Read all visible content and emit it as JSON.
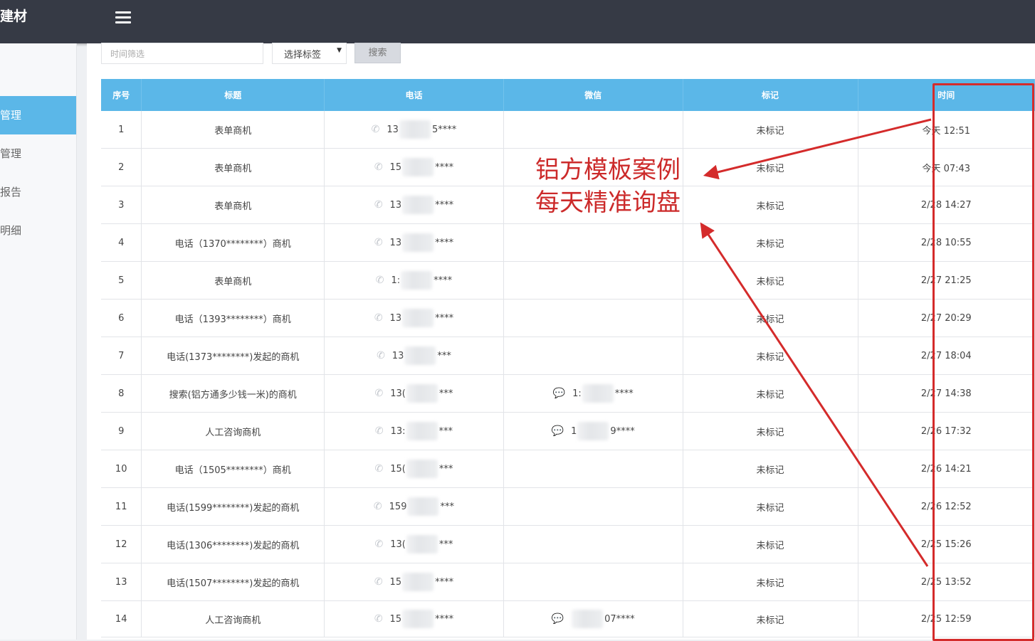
{
  "header": {
    "brand": "建材",
    "menu_icon": "hamburger-icon"
  },
  "sidebar": {
    "items": [
      {
        "label": "管理",
        "active": true
      },
      {
        "label": "管理",
        "active": false
      },
      {
        "label": "报告",
        "active": false
      },
      {
        "label": "明细",
        "active": false
      }
    ]
  },
  "filters": {
    "time_placeholder": "时间筛选",
    "tag_select": "选择标签",
    "search_label": "搜索"
  },
  "table": {
    "columns": [
      "序号",
      "标题",
      "电话",
      "微信",
      "标记",
      "时间"
    ],
    "rows": [
      {
        "no": "1",
        "title": "表单商机",
        "phone_prefix": "13",
        "phone_suffix": "5****",
        "wechat_prefix": "",
        "wechat_suffix": "",
        "mark": "未标记",
        "time": "今天 12:51"
      },
      {
        "no": "2",
        "title": "表单商机",
        "phone_prefix": "15",
        "phone_suffix": "****",
        "wechat_prefix": "",
        "wechat_suffix": "",
        "mark": "未标记",
        "time": "今天 07:43"
      },
      {
        "no": "3",
        "title": "表单商机",
        "phone_prefix": "13",
        "phone_suffix": "****",
        "wechat_prefix": "",
        "wechat_suffix": "",
        "mark": "未标记",
        "time": "2/28 14:27"
      },
      {
        "no": "4",
        "title": "电话（1370********）商机",
        "phone_prefix": "13",
        "phone_suffix": "****",
        "wechat_prefix": "",
        "wechat_suffix": "",
        "mark": "未标记",
        "time": "2/28 10:55"
      },
      {
        "no": "5",
        "title": "表单商机",
        "phone_prefix": "1:",
        "phone_suffix": "****",
        "wechat_prefix": "",
        "wechat_suffix": "",
        "mark": "未标记",
        "time": "2/27 21:25"
      },
      {
        "no": "6",
        "title": "电话（1393********）商机",
        "phone_prefix": "13",
        "phone_suffix": "****",
        "wechat_prefix": "",
        "wechat_suffix": "",
        "mark": "未标记",
        "time": "2/27 20:29"
      },
      {
        "no": "7",
        "title": "电话(1373********)发起的商机",
        "phone_prefix": "13",
        "phone_suffix": "***",
        "wechat_prefix": "",
        "wechat_suffix": "",
        "mark": "未标记",
        "time": "2/27 18:04"
      },
      {
        "no": "8",
        "title": "搜索(铝方通多少钱一米)的商机",
        "phone_prefix": "13(",
        "phone_suffix": "***",
        "wechat_prefix": "1:",
        "wechat_suffix": "****",
        "mark": "未标记",
        "time": "2/27 14:38"
      },
      {
        "no": "9",
        "title": "人工咨询商机",
        "phone_prefix": "13:",
        "phone_suffix": "***",
        "wechat_prefix": "1",
        "wechat_suffix": "9****",
        "mark": "未标记",
        "time": "2/26 17:32"
      },
      {
        "no": "10",
        "title": "电话（1505********）商机",
        "phone_prefix": "15(",
        "phone_suffix": "***",
        "wechat_prefix": "",
        "wechat_suffix": "",
        "mark": "未标记",
        "time": "2/26 14:21"
      },
      {
        "no": "11",
        "title": "电话(1599********)发起的商机",
        "phone_prefix": "159",
        "phone_suffix": "***",
        "wechat_prefix": "",
        "wechat_suffix": "",
        "mark": "未标记",
        "time": "2/26 12:52"
      },
      {
        "no": "12",
        "title": "电话(1306********)发起的商机",
        "phone_prefix": "13(",
        "phone_suffix": "***",
        "wechat_prefix": "",
        "wechat_suffix": "",
        "mark": "未标记",
        "time": "2/25 15:26"
      },
      {
        "no": "13",
        "title": "电话(1507********)发起的商机",
        "phone_prefix": "15",
        "phone_suffix": "****",
        "wechat_prefix": "",
        "wechat_suffix": "",
        "mark": "未标记",
        "time": "2/25 13:52"
      },
      {
        "no": "14",
        "title": "人工咨询商机",
        "phone_prefix": "15",
        "phone_suffix": "****",
        "wechat_prefix": "",
        "wechat_suffix": "07****",
        "mark": "未标记",
        "time": "2/25 12:59"
      }
    ]
  },
  "annotation": {
    "line1": "铝方模板案例",
    "line2": "每天精准询盘",
    "color": "#d42b2b"
  },
  "colors": {
    "header_bg": "#363a45",
    "accent": "#5bb7e8"
  }
}
